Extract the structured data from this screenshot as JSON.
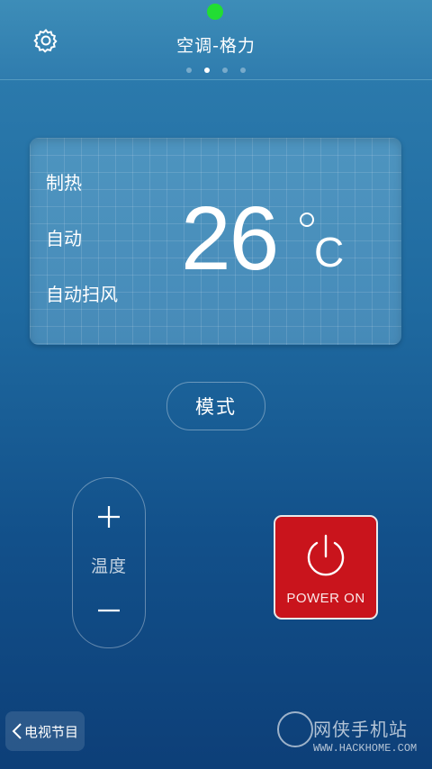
{
  "header": {
    "title": "空调-格力",
    "settings_icon": "gear-icon",
    "pager_total": 4,
    "pager_active": 2,
    "status_color": "#22dd33"
  },
  "display": {
    "mode": "制热",
    "fan_speed": "自动",
    "swing": "自动扫风",
    "temperature": "26",
    "unit": "C"
  },
  "controls": {
    "mode_label": "模式",
    "temp_label": "温度",
    "plus_icon": "plus-icon",
    "minus_icon": "minus-icon",
    "power_label": "POWER ON",
    "power_icon": "power-icon",
    "power_color": "#c9141c"
  },
  "footer": {
    "back_label": "电视节目",
    "back_icon": "chevron-left-icon",
    "watermark_text": "网侠手机站",
    "watermark_url": "WWW.HACKHOME.COM"
  }
}
